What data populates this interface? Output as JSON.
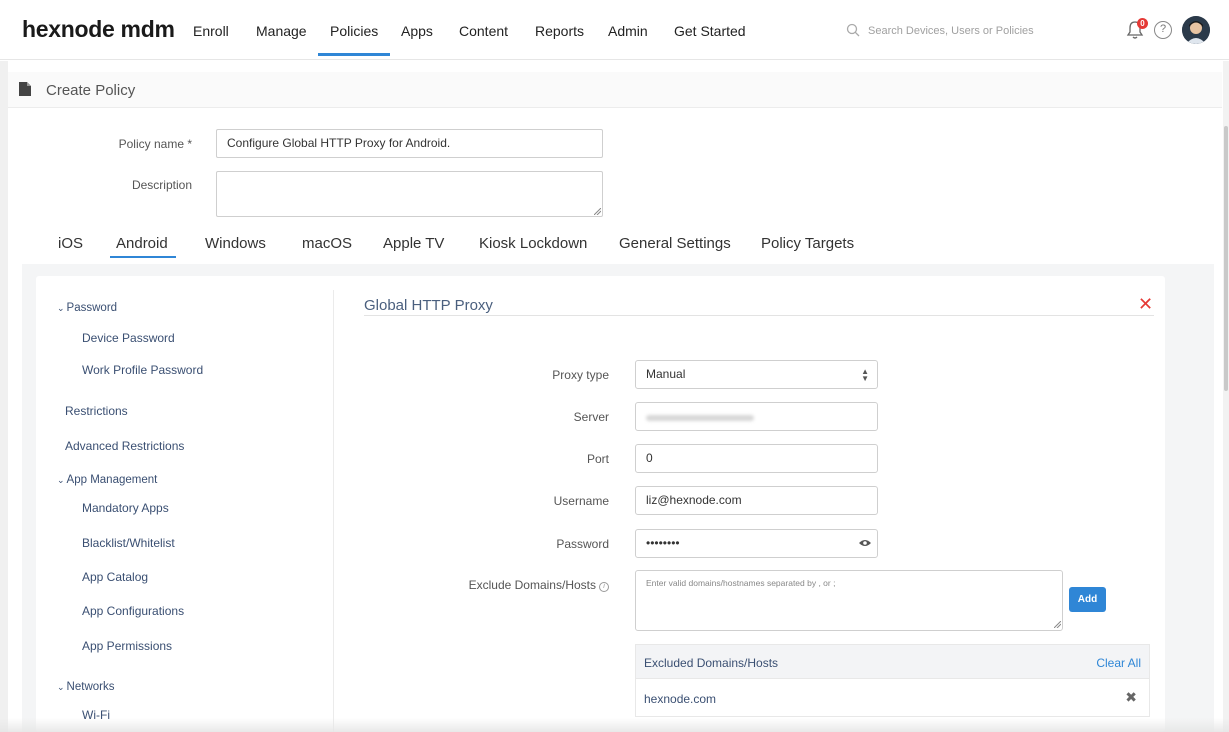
{
  "nav": {
    "brand": "hexnode mdm",
    "items": [
      "Enroll",
      "Manage",
      "Policies",
      "Apps",
      "Content",
      "Reports",
      "Admin",
      "Get Started"
    ],
    "active": "Policies",
    "search_placeholder": "Search Devices, Users or Policies",
    "notification_count": "0",
    "help": "?"
  },
  "page": {
    "title": "Create Policy"
  },
  "form": {
    "policy_name_label": "Policy name *",
    "policy_name_value": "Configure Global HTTP Proxy for Android.",
    "description_label": "Description",
    "description_value": ""
  },
  "tabs": [
    "iOS",
    "Android",
    "Windows",
    "macOS",
    "Apple TV",
    "Kiosk Lockdown",
    "General Settings",
    "Policy Targets"
  ],
  "active_tab": "Android",
  "sidebar": {
    "password_group": "Password",
    "device_password": "Device Password",
    "work_profile_password": "Work Profile Password",
    "restrictions": "Restrictions",
    "advanced_restrictions": "Advanced Restrictions",
    "app_management_group": "App Management",
    "mandatory_apps": "Mandatory Apps",
    "blacklist_whitelist": "Blacklist/Whitelist",
    "app_catalog": "App Catalog",
    "app_configurations": "App Configurations",
    "app_permissions": "App Permissions",
    "networks_group": "Networks",
    "wifi": "Wi-Fi"
  },
  "proxy": {
    "section_title": "Global HTTP Proxy",
    "proxy_type_label": "Proxy type",
    "proxy_type_value": "Manual",
    "server_label": "Server",
    "port_label": "Port",
    "port_value": "0",
    "username_label": "Username",
    "username_value": "liz@hexnode.com",
    "password_label": "Password",
    "password_value": "••••••••",
    "exclude_label": "Exclude Domains/Hosts",
    "exclude_placeholder": "Enter valid domains/hostnames separated by , or ;",
    "add_button": "Add",
    "table_header": "Excluded Domains/Hosts",
    "clear_all": "Clear All",
    "excluded": [
      "hexnode.com"
    ]
  },
  "colors": {
    "accent": "#2f86d6",
    "close": "#e53935",
    "sidebar_text": "#3a4f72"
  }
}
